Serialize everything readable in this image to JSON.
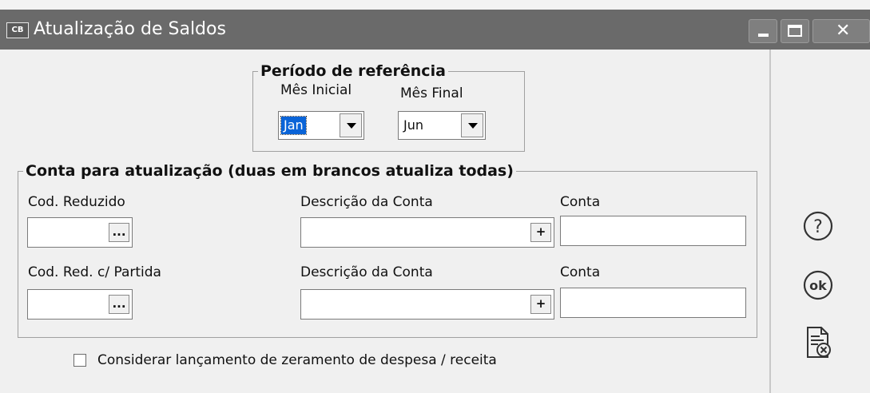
{
  "window": {
    "app_badge": "CB",
    "title": "Atualização de Saldos"
  },
  "periodo": {
    "legend": "Período de referência",
    "mes_inicial_label": "Mês Inicial",
    "mes_inicial_value": "Jan",
    "mes_final_label": "Mês Final",
    "mes_final_value": "Jun"
  },
  "conta": {
    "legend": "Conta para atualização (duas em brancos atualiza todas)",
    "row1": {
      "cod_label": "Cod. Reduzido",
      "cod_value": "",
      "cod_button": "...",
      "descricao_label": "Descrição da Conta",
      "descricao_value": "",
      "descricao_button": "+",
      "conta_label": "Conta",
      "conta_value": ""
    },
    "row2": {
      "cod_label": "Cod. Red. c/ Partida",
      "cod_value": "",
      "cod_button": "...",
      "descricao_label": "Descrição da Conta",
      "descricao_value": "",
      "descricao_button": "+",
      "conta_label": "Conta",
      "conta_value": ""
    }
  },
  "checkbox": {
    "label": "Considerar lançamento de zeramento de despesa / receita",
    "checked": false
  },
  "side_icons": {
    "help": "help-icon",
    "ok": "ok-icon",
    "cancel": "document-cancel-icon"
  },
  "colors": {
    "titlebar": "#6a6a6a",
    "selection": "#0a64d8",
    "background": "#f0f0f0"
  }
}
